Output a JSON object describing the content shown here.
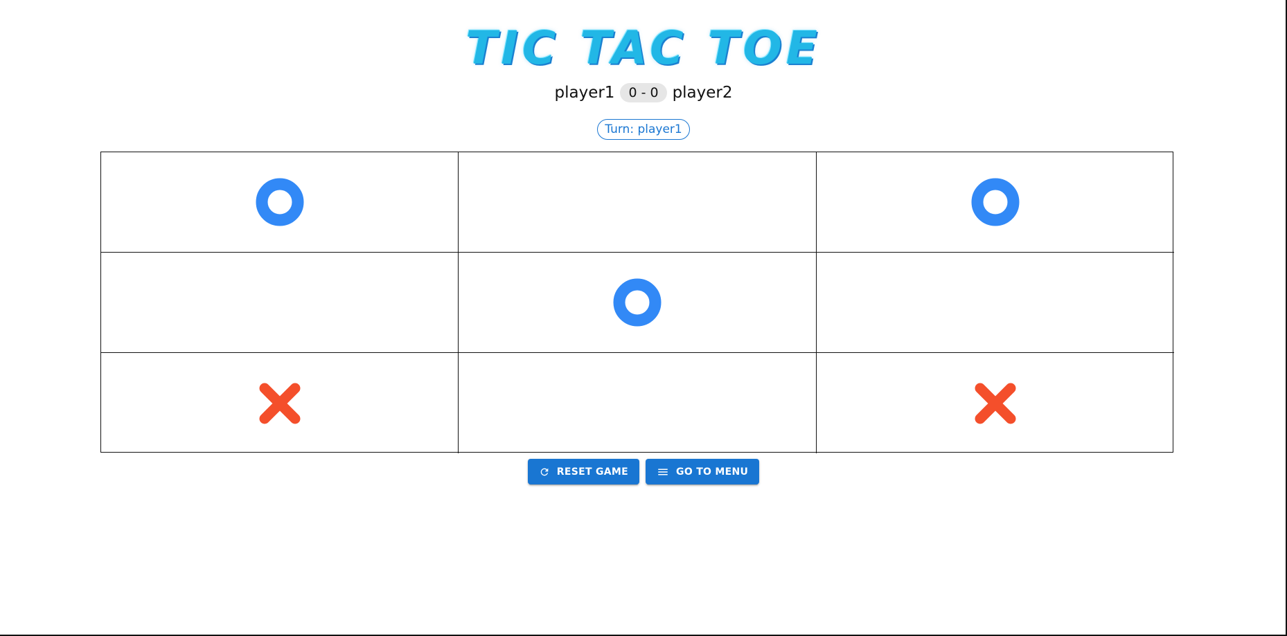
{
  "title": "TIC TAC TOE",
  "score": {
    "player1": "player1",
    "separator_value": "0 - 0",
    "player2": "player2"
  },
  "turn": "Turn: player1",
  "board": [
    [
      "O",
      "",
      "O"
    ],
    [
      "",
      "O",
      ""
    ],
    [
      "X",
      "",
      "X"
    ]
  ],
  "marks": {
    "O": {
      "color": "#3289f6",
      "icon": "o-mark-icon"
    },
    "X": {
      "color": "#f44f2b",
      "icon": "x-mark-icon"
    }
  },
  "buttons": {
    "reset": {
      "label": "RESET GAME",
      "icon": "refresh-icon"
    },
    "menu": {
      "label": "GO TO MENU",
      "icon": "menu-icon"
    }
  },
  "colors": {
    "primary": "#1976d2",
    "title": "#22b7e6"
  }
}
